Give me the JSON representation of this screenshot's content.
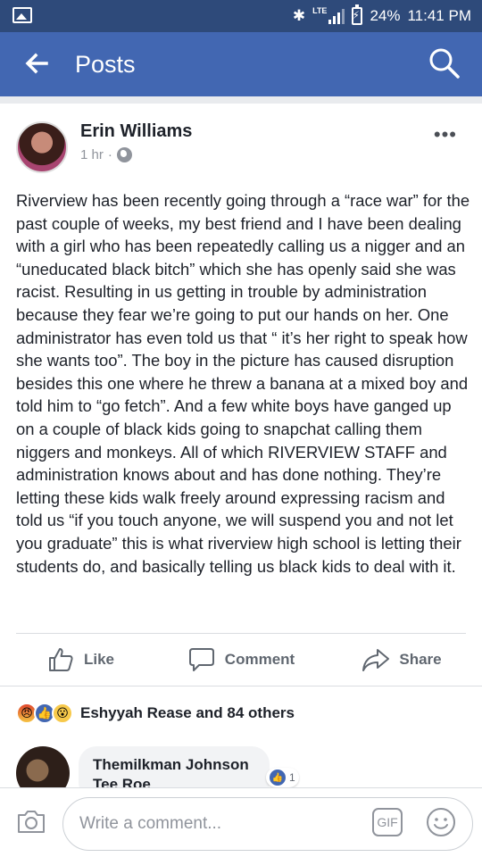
{
  "status_bar": {
    "network": "LTE",
    "battery": "24%",
    "time": "11:41 PM",
    "icons": [
      "gallery-icon",
      "bluetooth-icon",
      "signal-icon",
      "battery-charging-icon"
    ]
  },
  "appbar": {
    "title": "Posts",
    "icons": [
      "back-arrow-icon",
      "search-icon"
    ]
  },
  "post": {
    "author": "Erin Williams",
    "time": "1 hr",
    "separator": "·",
    "privacy_icon": "globe-icon",
    "more_label": "•••",
    "body": "Riverview has been recently going through a “race war” for the past couple of weeks, my best friend and I have been dealing with a girl who has been repeatedly calling  us a nigger and an “uneducated black bitch” which she has openly said she was racist. Resulting in us getting in trouble by administration because they fear we’re going to put our hands on her. One administrator has even told us that “ it’s her right to speak how she wants too”.  The boy in the picture has caused disruption besides this one where he threw a banana at a mixed boy and told him to “go fetch”. And a few white boys have ganged up on a couple of black kids going to snapchat calling them niggers and monkeys. All of which RIVERVIEW STAFF and administration knows about and has done nothing. They’re letting these kids walk freely around expressing racism and told us “if you touch anyone, we will suspend you and not let you graduate” this is what riverview high school is letting their students do, and basically telling us black kids to deal with it.",
    "actions": [
      {
        "label": "Like",
        "icon": "thumbs-up-icon"
      },
      {
        "label": "Comment",
        "icon": "comment-icon"
      },
      {
        "label": "Share",
        "icon": "share-icon"
      }
    ],
    "reactions": {
      "icons": [
        "angry-reaction-icon",
        "like-reaction-icon",
        "wow-reaction-icon"
      ],
      "summary": "Eshyyah Rease and 84 others"
    }
  },
  "comment": {
    "author": "Themilkman Johnson",
    "text": "Tee Roe",
    "like_count": "1"
  },
  "composer": {
    "placeholder": "Write a comment...",
    "gif_label": "GIF",
    "icons": [
      "camera-icon",
      "gif-icon",
      "emoji-icon"
    ]
  }
}
